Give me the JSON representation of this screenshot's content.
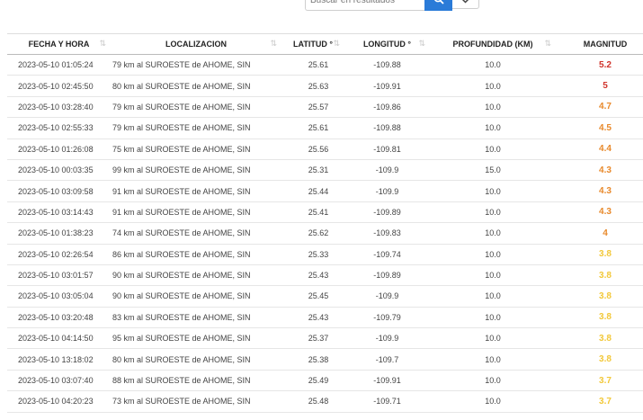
{
  "search": {
    "placeholder": "Buscar en resultados"
  },
  "colors": {
    "accent": "#2a7bd8",
    "mag_high": "#d0342c",
    "mag_mid": "#e8892b",
    "mag_low": "#f2c83a"
  },
  "table": {
    "columns": [
      "FECHA Y HORA",
      "LOCALIZACION",
      "LATITUD °",
      "LONGITUD °",
      "PROFUNDIDAD (KM)",
      "MAGNITUD"
    ],
    "sort_glyph": "⇅",
    "rows": [
      {
        "fecha": "2023-05-10  01:05:24",
        "loc": "79 km al SUROESTE de AHOME, SIN",
        "lat": "25.61",
        "lon": "-109.88",
        "prof": "10.0",
        "mag": "5.2",
        "level": "high"
      },
      {
        "fecha": "2023-05-10  02:45:50",
        "loc": "80 km al SUROESTE de AHOME, SIN",
        "lat": "25.63",
        "lon": "-109.91",
        "prof": "10.0",
        "mag": "5",
        "level": "high"
      },
      {
        "fecha": "2023-05-10  03:28:40",
        "loc": "79 km al SUROESTE de AHOME, SIN",
        "lat": "25.57",
        "lon": "-109.86",
        "prof": "10.0",
        "mag": "4.7",
        "level": "mid"
      },
      {
        "fecha": "2023-05-10  02:55:33",
        "loc": "79 km al SUROESTE de AHOME, SIN",
        "lat": "25.61",
        "lon": "-109.88",
        "prof": "10.0",
        "mag": "4.5",
        "level": "mid"
      },
      {
        "fecha": "2023-05-10  01:26:08",
        "loc": "75 km al SUROESTE de AHOME, SIN",
        "lat": "25.56",
        "lon": "-109.81",
        "prof": "10.0",
        "mag": "4.4",
        "level": "mid"
      },
      {
        "fecha": "2023-05-10  00:03:35",
        "loc": "99 km al SUROESTE de AHOME, SIN",
        "lat": "25.31",
        "lon": "-109.9",
        "prof": "15.0",
        "mag": "4.3",
        "level": "mid"
      },
      {
        "fecha": "2023-05-10  03:09:58",
        "loc": "91 km al SUROESTE de AHOME, SIN",
        "lat": "25.44",
        "lon": "-109.9",
        "prof": "10.0",
        "mag": "4.3",
        "level": "mid"
      },
      {
        "fecha": "2023-05-10  03:14:43",
        "loc": "91 km al SUROESTE de AHOME, SIN",
        "lat": "25.41",
        "lon": "-109.89",
        "prof": "10.0",
        "mag": "4.3",
        "level": "mid"
      },
      {
        "fecha": "2023-05-10  01:38:23",
        "loc": "74 km al SUROESTE de AHOME, SIN",
        "lat": "25.62",
        "lon": "-109.83",
        "prof": "10.0",
        "mag": "4",
        "level": "mid"
      },
      {
        "fecha": "2023-05-10  02:26:54",
        "loc": "86 km al SUROESTE de AHOME, SIN",
        "lat": "25.33",
        "lon": "-109.74",
        "prof": "10.0",
        "mag": "3.8",
        "level": "low"
      },
      {
        "fecha": "2023-05-10  03:01:57",
        "loc": "90 km al SUROESTE de AHOME, SIN",
        "lat": "25.43",
        "lon": "-109.89",
        "prof": "10.0",
        "mag": "3.8",
        "level": "low"
      },
      {
        "fecha": "2023-05-10  03:05:04",
        "loc": "90 km al SUROESTE de AHOME, SIN",
        "lat": "25.45",
        "lon": "-109.9",
        "prof": "10.0",
        "mag": "3.8",
        "level": "low"
      },
      {
        "fecha": "2023-05-10  03:20:48",
        "loc": "83 km al SUROESTE de AHOME, SIN",
        "lat": "25.43",
        "lon": "-109.79",
        "prof": "10.0",
        "mag": "3.8",
        "level": "low"
      },
      {
        "fecha": "2023-05-10  04:14:50",
        "loc": "95 km al SUROESTE de AHOME, SIN",
        "lat": "25.37",
        "lon": "-109.9",
        "prof": "10.0",
        "mag": "3.8",
        "level": "low"
      },
      {
        "fecha": "2023-05-10  13:18:02",
        "loc": "80 km al SUROESTE de AHOME, SIN",
        "lat": "25.38",
        "lon": "-109.7",
        "prof": "10.0",
        "mag": "3.8",
        "level": "low"
      },
      {
        "fecha": "2023-05-10  03:07:40",
        "loc": "88 km al SUROESTE de AHOME, SIN",
        "lat": "25.49",
        "lon": "-109.91",
        "prof": "10.0",
        "mag": "3.7",
        "level": "low"
      },
      {
        "fecha": "2023-05-10  04:20:23",
        "loc": "73 km al SUROESTE de AHOME, SIN",
        "lat": "25.48",
        "lon": "-109.71",
        "prof": "10.0",
        "mag": "3.7",
        "level": "low"
      }
    ]
  }
}
